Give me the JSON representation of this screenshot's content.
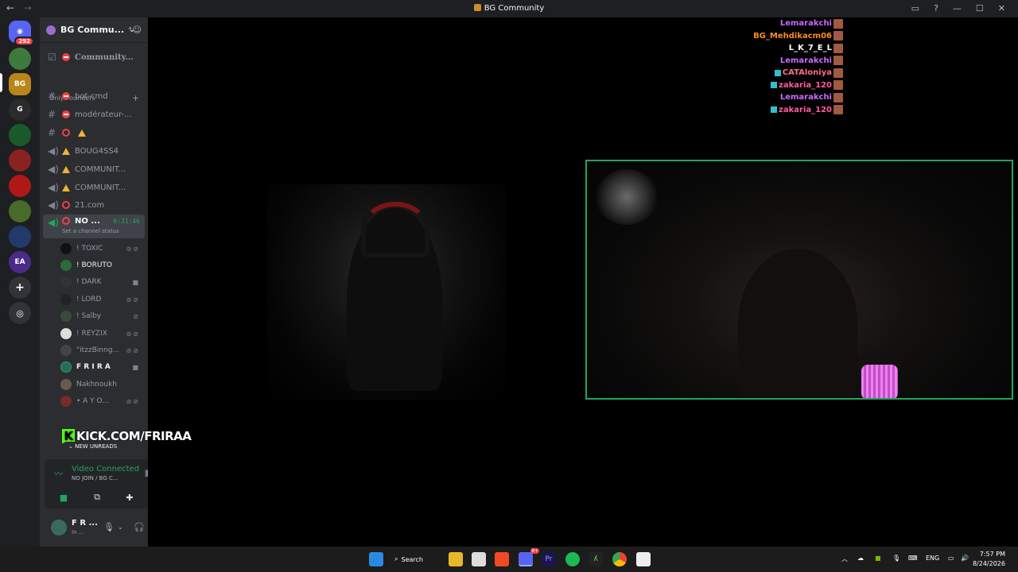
{
  "window": {
    "title": "BG Community",
    "nav_back": "←",
    "nav_forward": "→"
  },
  "rail": {
    "home_badge": "292"
  },
  "server": {
    "name": "BG Commu...",
    "channels": [
      {
        "label": "Community..."
      },
      {
        "label": "bot-cmd"
      },
      {
        "label": "modérateur-..."
      },
      {
        "label": ""
      },
      {
        "label": "BOUG4SS4"
      },
      {
        "label": "COMMUNIT..."
      },
      {
        "label": "COMMUNIT..."
      },
      {
        "label": "21.com"
      }
    ],
    "category": "Only Founders",
    "active_channel": {
      "label": "NO ...",
      "timer": "6:31:46",
      "status": "Set a channel status"
    },
    "voice_users": [
      {
        "name": "! TOXIC"
      },
      {
        "name": "! BORUTO"
      },
      {
        "name": "! DARK"
      },
      {
        "name": "! LORD"
      },
      {
        "name": "! Salby"
      },
      {
        "name": "! REYZIX"
      },
      {
        "name": "\"itzzBinng..."
      },
      {
        "name": "F R I R A"
      },
      {
        "name": "Nakhnoukh"
      },
      {
        "name": "• A Y O..."
      }
    ],
    "new_unreads": "NEW UNREADS"
  },
  "overlay": {
    "kick_text": "KICK.COM/FRIRAA",
    "kick_logo": "K"
  },
  "voice_panel": {
    "status": "Video Connected",
    "channel": "NO JOIN / BG C..."
  },
  "user_panel": {
    "name": "F R ...",
    "status": "In ..."
  },
  "chat": [
    {
      "name": "Lemarakchi",
      "color": "#c86bff"
    },
    {
      "name": "BG_Mehdikacm06",
      "color": "#ff8c1a"
    },
    {
      "name": "L_K_7_E_L",
      "color": "#ffffff"
    },
    {
      "name": "Lemarakchi",
      "color": "#c86bff"
    },
    {
      "name": "CATAloniya",
      "color": "#ff6b8a"
    },
    {
      "name": "zakaria_120",
      "color": "#ff5a9e"
    },
    {
      "name": "Lemarakchi",
      "color": "#c86bff"
    },
    {
      "name": "zakaria_120",
      "color": "#ff5a9e"
    }
  ],
  "taskbar": {
    "search": "Search",
    "discord_badge": "9+",
    "lang": "ENG",
    "time": "7:57 PM",
    "date": "8/24/2026"
  },
  "colors": {
    "accent_green": "#23a55a",
    "danger": "#f23f43",
    "kick_green": "#53fc18"
  }
}
